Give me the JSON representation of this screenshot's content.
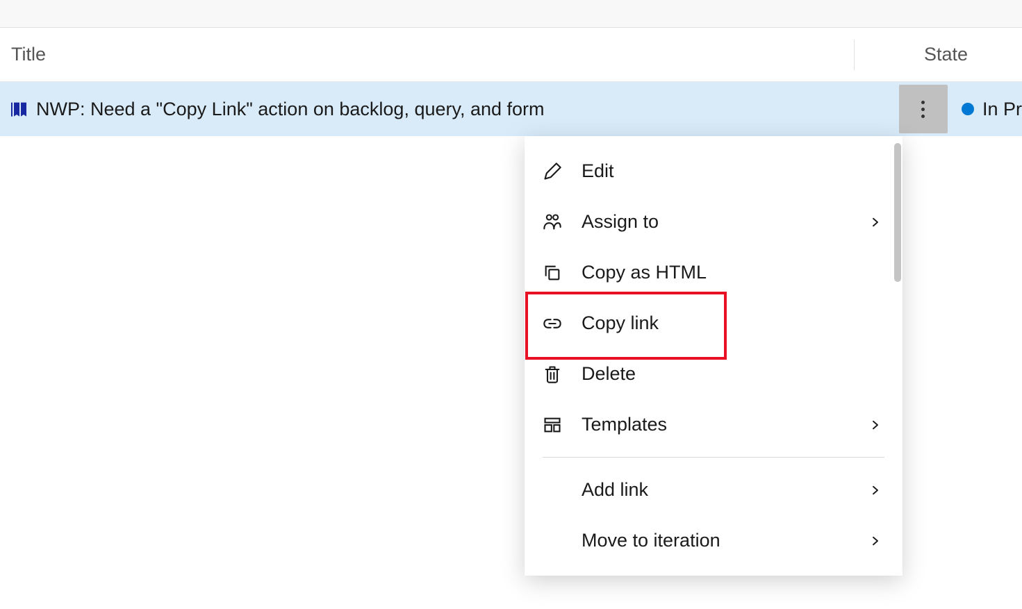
{
  "header": {
    "title_label": "Title",
    "state_label": "State"
  },
  "item": {
    "title": "NWP: Need a \"Copy Link\" action on backlog, query, and form",
    "state_text": "In Pr",
    "state_color": "#0078d4"
  },
  "menu": {
    "edit": "Edit",
    "assign_to": "Assign to",
    "copy_html": "Copy as HTML",
    "copy_link": "Copy link",
    "delete": "Delete",
    "templates": "Templates",
    "add_link": "Add link",
    "move_to_iteration": "Move to iteration"
  }
}
